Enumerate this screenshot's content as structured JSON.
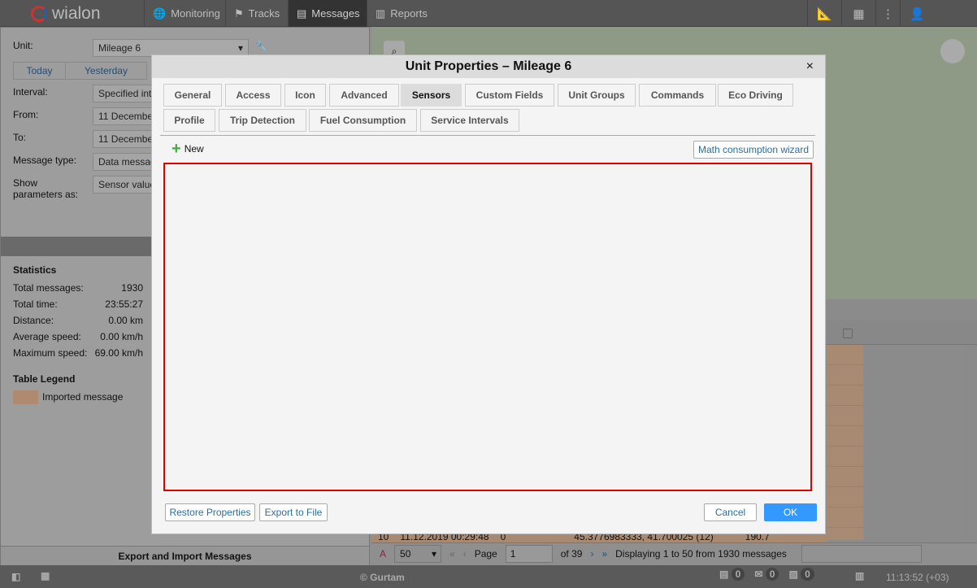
{
  "topbar": {
    "logo": "wialon",
    "nav": [
      "Monitoring",
      "Tracks",
      "Messages",
      "Reports"
    ]
  },
  "left": {
    "unit_label": "Unit:",
    "unit_value": "Mileage 6",
    "today": "Today",
    "yesterday": "Yesterday",
    "interval_label": "Interval:",
    "interval_value": "Specified interval",
    "from_label": "From:",
    "from_value": "11 December",
    "to_label": "To:",
    "to_value": "11 December",
    "msgtype_label": "Message type:",
    "msgtype_value": "Data messages",
    "show_label1": "Show",
    "show_label2": "parameters as:",
    "show_value": "Sensor values",
    "stats_title": "Statistics",
    "stats": [
      {
        "k": "Total messages:",
        "v": "1930"
      },
      {
        "k": "Total time:",
        "v": "23:55:27"
      },
      {
        "k": "Distance:",
        "v": "0.00 km"
      },
      {
        "k": "Average speed:",
        "v": "0.00 km/h"
      },
      {
        "k": "Maximum speed:",
        "v": "69.00 km/h"
      }
    ],
    "legend_title": "Table Legend",
    "legend_item": "Imported message",
    "export": "Export and Import Messages"
  },
  "grid": {
    "row10": [
      "10",
      "11.12.2019 00:29:48",
      "0",
      "45.3776983333, 41.700025 (12)",
      "190.7"
    ]
  },
  "pager": {
    "per_page": "50",
    "page_label": "Page",
    "page": "1",
    "of": "of 39",
    "display": "Displaying 1 to 50 from 1930 messages"
  },
  "footer": {
    "copyright": "© Gurtam",
    "c1": "0",
    "c2": "0",
    "c3": "0",
    "time": "11:13:52 (+03)"
  },
  "dialog": {
    "title": "Unit Properties – Mileage 6",
    "close": "×",
    "tabs_row1": [
      "General",
      "Access",
      "Icon",
      "Advanced",
      "Sensors",
      "Custom Fields",
      "Unit Groups",
      "Commands",
      "Eco Driving"
    ],
    "tabs_row2": [
      "Profile",
      "Trip Detection",
      "Fuel Consumption",
      "Service Intervals"
    ],
    "new": "New",
    "wizard": "Math consumption wizard",
    "restore": "Restore Properties",
    "export": "Export to File",
    "cancel": "Cancel",
    "ok": "OK"
  }
}
